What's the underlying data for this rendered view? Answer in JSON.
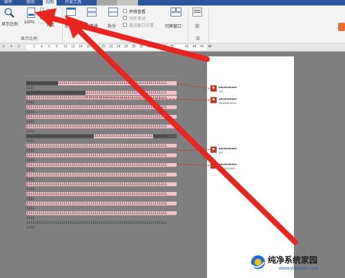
{
  "ribbon": {
    "tabs": [
      {
        "label": "邮件"
      },
      {
        "label": "审阅"
      },
      {
        "label": "视图"
      },
      {
        "label": "开发工具"
      }
    ],
    "show_ratio": {
      "zoom_label": "显示比例",
      "hundred_label": "100%",
      "one_page": "单页",
      "multi_page": "多页",
      "page_width": "页宽",
      "group_label": "显示比例"
    },
    "window": {
      "new_window": "新",
      "arrange_all": "全部重排",
      "split": "拆分",
      "side_by_side": "并排查看",
      "sync_scroll": "同步滚动",
      "reset_position": "重设窗口位置",
      "group_label": "窗口"
    },
    "switch_window": "切换窗口",
    "macros": "宏",
    "macros_group": "宏"
  },
  "ruler": {
    "ticks": [
      "6",
      "4",
      "2",
      "",
      "2",
      "4",
      "6",
      "8",
      "10",
      "12",
      "14",
      "16",
      "18",
      "20",
      "22",
      "24",
      "26",
      "28",
      "30",
      "32",
      "34",
      "36",
      "38",
      "",
      "42",
      "44",
      "46",
      "48"
    ]
  },
  "document": {
    "lines": [
      {
        "text": "11111111111111111111111111111111111111111111111111111111111111111111"
      },
      {
        "text": "1111"
      },
      {
        "text": "11111111111111111111111111111111111111111111111111111111111111111111"
      },
      {
        "text": "11111111111111111111111111111111111111111111111111111111111111111111"
      },
      {
        "text": "1111"
      },
      {
        "text": "11111111111111111111111111111111111111111111111111111111111111111111"
      },
      {
        "text": "1111"
      },
      {
        "text": "11111111111111111111111111111111111111111111111111111111111111111111"
      },
      {
        "text": "1111"
      },
      {
        "text": "11111111111111111111111111111111111111111111111111111111111111111111"
      },
      {
        "text": "1111"
      },
      {
        "text": "11111111111111111111111111111111111111111111111111111111111111111111"
      },
      {
        "text": "1111"
      },
      {
        "text": "11111111111111111111111111111111111111111111111111111111111111111111"
      },
      {
        "text": "1111"
      },
      {
        "text": "11111111111111111111111111111111111111111111111111111111111111111111"
      },
      {
        "text": "1111"
      },
      {
        "text": "11111111111111111111111111111111111111111111111111111111111111111111"
      },
      {
        "text": "1111"
      },
      {
        "text": "11111111111111111111111111111111111111111111111111111111111111111111"
      },
      {
        "text": "1111"
      },
      {
        "text": "11111111111111111111111111111111111111111111111111111111111111111111"
      },
      {
        "text": "1111"
      },
      {
        "text": "11111111111111111111111111111111111111111111111111111111111111111111"
      },
      {
        "text": "1111"
      },
      {
        "text": "11111111111111111111111111111111111111111111111111111111111111111111"
      },
      {
        "text": "1111"
      },
      {
        "text": "11111111111111111111111111111111111111111111111111111111111111111111"
      },
      {
        "text": "1111"
      },
      {
        "text": "11111111111111111111111111111111111111111111111111111111111111111111"
      },
      {
        "text": "1111"
      }
    ]
  },
  "comments": [
    {
      "author": "Administrator",
      "body": "111"
    },
    {
      "author": "Administrator",
      "body": "1111111111111"
    },
    {
      "author": "Administrator",
      "body": "111"
    },
    {
      "author": "Administrator",
      "body": "111111111111"
    }
  ],
  "watermark": {
    "title": "纯净系统家园",
    "url": "www.yidaimei.com"
  },
  "colors": {
    "annotation_red": "#e8251f",
    "highlight_pink": "#f3c4cb",
    "ribbon_blue": "#2b579a"
  }
}
